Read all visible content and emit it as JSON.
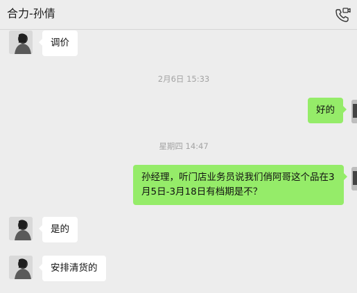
{
  "header": {
    "title": "合力-孙倩",
    "call_icon": "phone-video-call-icon"
  },
  "messages": [
    {
      "side": "left",
      "text": "调价"
    },
    {
      "type": "time",
      "text": "2月6日 15:33"
    },
    {
      "side": "right",
      "text": "好的"
    },
    {
      "type": "time",
      "text": "星期四 14:47"
    },
    {
      "side": "right",
      "text": "孙经理，听门店业务员说我们俏阿哥这个品在3月5日-3月18日有档期是不？"
    },
    {
      "side": "left",
      "text": "是的"
    },
    {
      "side": "left",
      "text": "安排清货的"
    }
  ],
  "colors": {
    "background": "#ededed",
    "incoming_bubble": "#ffffff",
    "outgoing_bubble": "#95ec69",
    "timestamp": "#a3a3a3"
  }
}
